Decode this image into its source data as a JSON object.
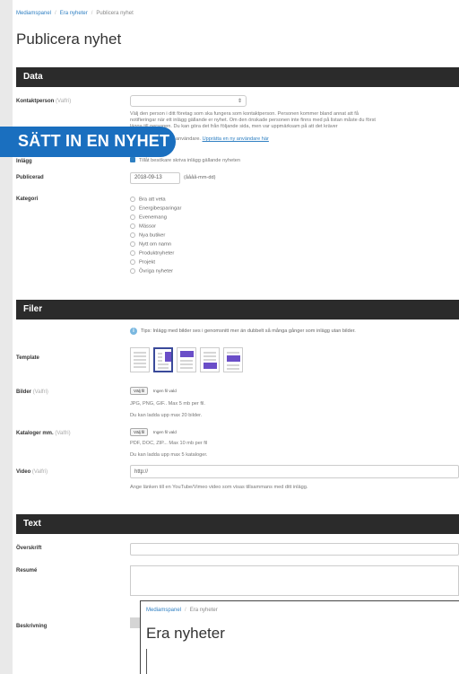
{
  "breadcrumb": {
    "home": "Mediamspanel",
    "parent": "Era nyheter",
    "current": "Publicera nyhet"
  },
  "page_title": "Publicera nyhet",
  "banner": "SÄTT IN EN NYHET",
  "sections": {
    "data": "Data",
    "files": "Filer",
    "text": "Text"
  },
  "data": {
    "contact_label": "Kontaktperson",
    "optional": "(Valfri)",
    "contact_help_1": "Välj den person i ditt företag som ska fungera som kontaktperson. Personen kommer bland annat att få",
    "contact_help_2": "notifieringar när ett inlägg gällande er nyhet. Om den önskade personen inte finns med på listan måste du först",
    "contact_help_3": "lägga till personen. Du kan göra det från följande sida, men var uppmärksam på att det kräver",
    "contact_help_4": "att du har skapat en användare.",
    "contact_link": "Upprätta en ny användare här",
    "post_label": "Inlägg",
    "post_checkbox": "Tillåt besökare skriva inlägg gällande nyheten",
    "published_label": "Publicerad",
    "published_value": "2018-09-13",
    "published_format": "(åååå-mm-dd)",
    "category_label": "Kategori",
    "categories": [
      "Bra att veta",
      "Energibesparingar",
      "Evenemang",
      "Mässor",
      "Nya butiker",
      "Nytt om namn",
      "Produktnyheter",
      "Projekt",
      "Övriga nyheter"
    ]
  },
  "files": {
    "tip": "Tips: Inlägg med bilder ses i genomsnitt mer än dubbelt så många gånger som inlägg utan bilder.",
    "template_label": "Template",
    "images_label": "Bilder",
    "choose_file": "Välj fil",
    "no_file": "Ingen fil vald",
    "images_formats": "JPG, PNG, GIF.. Max 5 mb per fil.",
    "images_max": "Du kan ladda upp max 20 bilder.",
    "catalogs_label": "Kataloger mm.",
    "catalogs_formats": "PDF, DOC, ZIP... Max 10 mb per fil",
    "catalogs_max": "Du kan ladda upp max 5 kataloger.",
    "video_label": "Video",
    "video_value": "http://",
    "video_help": "Ange länken till en YouTube/Vimeo video som visas tillsammans med ditt inlägg."
  },
  "text": {
    "heading_label": "Överskrift",
    "summary_label": "Resumé",
    "description_label": "Beskrivning"
  },
  "overlay": {
    "home": "Mediamspanel",
    "current": "Era nyheter",
    "title": "Era nyheter"
  },
  "colors": {
    "accent": "#2e7fc2",
    "banner": "#1a6fbf",
    "section_bg": "#2b2b2b",
    "template_block": "#6a4ec8"
  }
}
